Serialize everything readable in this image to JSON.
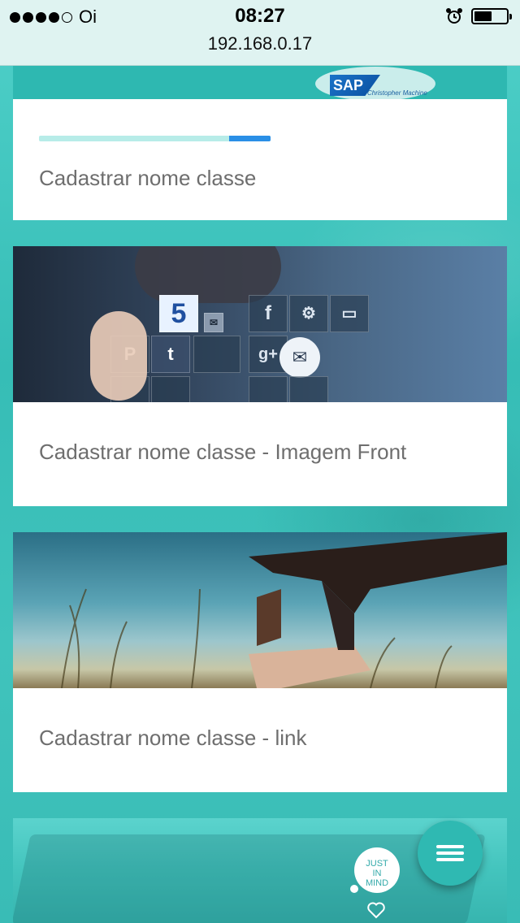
{
  "status_bar": {
    "carrier": "Oi",
    "signal_bars_filled": 4,
    "signal_bars_total": 5,
    "time": "08:27",
    "url": "192.168.0.17",
    "battery_level": 0.55
  },
  "header_banner": {
    "logo_text": "SAP",
    "logo_subtext": "Christopher Machine"
  },
  "cards": [
    {
      "title": "Cadastrar nome classe",
      "progress": 0.18,
      "image": "none"
    },
    {
      "title": "Cadastrar nome classe - Imagem Front",
      "image": "social-media-tiles"
    },
    {
      "title": "Cadastrar nome classe - link",
      "image": "hands-frame-sky"
    },
    {
      "title": "",
      "image": "laptop-teal"
    }
  ],
  "social_tiles": [
    "5",
    "",
    "f",
    "",
    "",
    "",
    "",
    "g+",
    "",
    ""
  ],
  "brand_logo": {
    "text_lines": [
      "JUST",
      "IN",
      "MIND"
    ]
  },
  "icons": {
    "alarm": "alarm-icon",
    "battery": "battery-icon",
    "menu": "menu-icon",
    "heart": "heart-icon"
  },
  "colors": {
    "background": "#3fc3bd",
    "progress_track": "#b7ece8",
    "progress_fill": "#2a8fe6",
    "fab": "#2fb9b2",
    "title_text": "#6e6e6e"
  }
}
